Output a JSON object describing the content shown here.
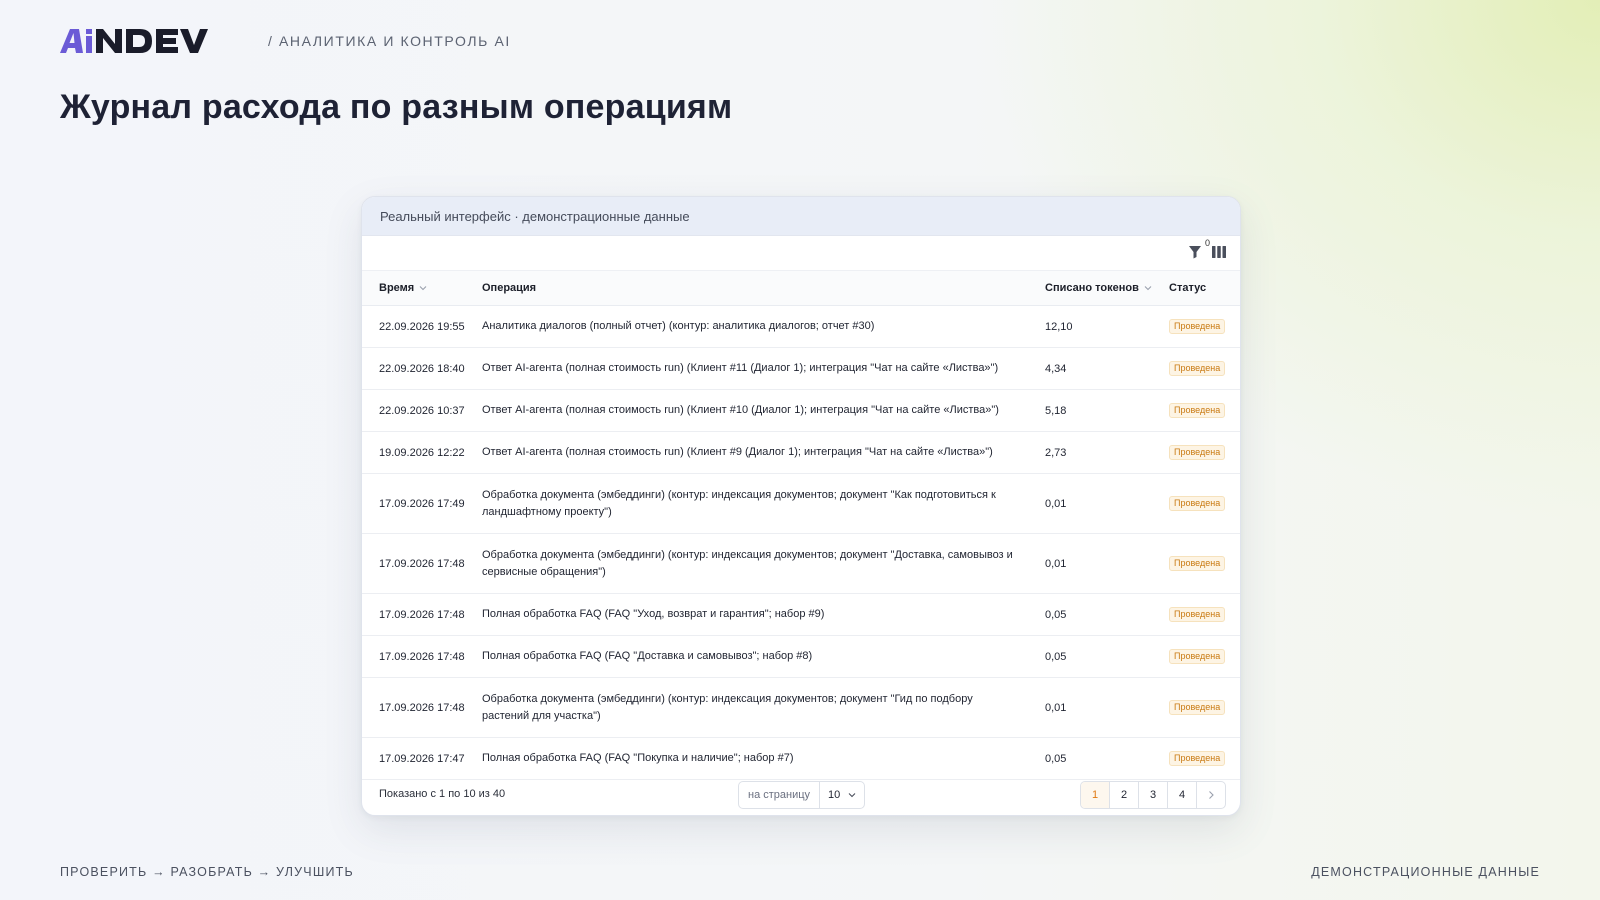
{
  "brand": {
    "logo_text": "AiNDEV",
    "accent": "#6b5bd6",
    "dark": "#1a1c2a"
  },
  "header": {
    "breadcrumb": "/ АНАЛИТИКА И КОНТРОЛЬ AI"
  },
  "page": {
    "title": "Журнал расхода по разным операциям"
  },
  "card": {
    "banner": "Реальный интерфейс · демонстрационные данные",
    "toolbar": {
      "filter_icon": "filter-icon",
      "filter_count": "0",
      "columns_icon": "columns-icon"
    }
  },
  "table": {
    "columns": {
      "time": "Время",
      "operation": "Операция",
      "tokens": "Списано токенов",
      "status": "Статус"
    },
    "status_color": "#c97a12",
    "rows": [
      {
        "time": "22.09.2026 19:55",
        "operation": "Аналитика диалогов (полный отчет) (контур: аналитика диалогов; отчет #30)",
        "tokens": "12,10",
        "status": "Проведена"
      },
      {
        "time": "22.09.2026 18:40",
        "operation": "Ответ AI-агента (полная стоимость run) (Клиент #11 (Диалог 1); интеграция \"Чат на сайте «Листва»\")",
        "tokens": "4,34",
        "status": "Проведена"
      },
      {
        "time": "22.09.2026 10:37",
        "operation": "Ответ AI-агента (полная стоимость run) (Клиент #10 (Диалог 1); интеграция \"Чат на сайте «Листва»\")",
        "tokens": "5,18",
        "status": "Проведена"
      },
      {
        "time": "19.09.2026 12:22",
        "operation": "Ответ AI-агента (полная стоимость run) (Клиент #9 (Диалог 1); интеграция \"Чат на сайте «Листва»\")",
        "tokens": "2,73",
        "status": "Проведена"
      },
      {
        "time": "17.09.2026 17:49",
        "operation": "Обработка документа (эмбеддинги) (контур: индексация документов; документ \"Как подготовиться к ландшафтному проекту\")",
        "tokens": "0,01",
        "status": "Проведена"
      },
      {
        "time": "17.09.2026 17:48",
        "operation": "Обработка документа (эмбеддинги) (контур: индексация документов; документ \"Доставка, самовывоз и сервисные обращения\")",
        "tokens": "0,01",
        "status": "Проведена"
      },
      {
        "time": "17.09.2026 17:48",
        "operation": "Полная обработка FAQ (FAQ \"Уход, возврат и гарантия\"; набор #9)",
        "tokens": "0,05",
        "status": "Проведена"
      },
      {
        "time": "17.09.2026 17:48",
        "operation": "Полная обработка FAQ (FAQ \"Доставка и самовывоз\"; набор #8)",
        "tokens": "0,05",
        "status": "Проведена"
      },
      {
        "time": "17.09.2026 17:48",
        "operation": "Обработка документа (эмбеддинги) (контур: индексация документов; документ \"Гид по подбору растений для участка\")",
        "tokens": "0,01",
        "status": "Проведена"
      },
      {
        "time": "17.09.2026 17:47",
        "operation": "Полная обработка FAQ (FAQ \"Покупка и наличие\"; набор #7)",
        "tokens": "0,05",
        "status": "Проведена"
      }
    ]
  },
  "pagination": {
    "shown": "Показано с 1 по 10 из 40",
    "per_page_label": "на страницу",
    "per_page_value": "10",
    "pages": [
      "1",
      "2",
      "3",
      "4"
    ],
    "current_page": "1",
    "active_color": "#e07a12"
  },
  "footer": {
    "left": "ПРОВЕРИТЬ → РАЗОБРАТЬ → УЛУЧШИТЬ",
    "right": "ДЕМОНСТРАЦИОННЫЕ ДАННЫЕ"
  }
}
